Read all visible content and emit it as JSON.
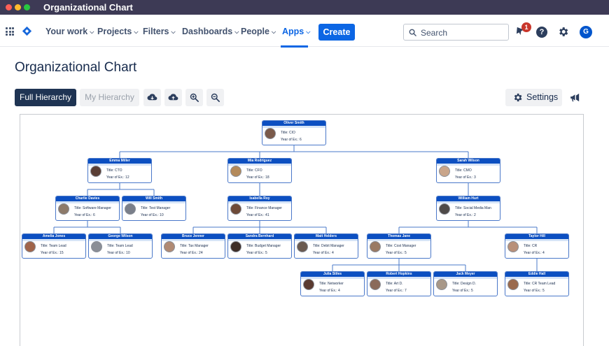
{
  "window": {
    "title": "Organizational Chart"
  },
  "nav": {
    "items": [
      {
        "label": "Your work",
        "caret": true
      },
      {
        "label": "Projects",
        "caret": true
      },
      {
        "label": "Filters",
        "caret": true
      },
      {
        "label": "Dashboards",
        "caret": true
      },
      {
        "label": "People",
        "caret": true
      },
      {
        "label": "Apps",
        "caret": true,
        "active": true
      }
    ],
    "create_label": "Create",
    "search_placeholder": "Search",
    "notification_count": "1",
    "help_glyph": "?",
    "avatar_initial": "G",
    "icons": [
      "app-switcher-icon",
      "jira-logo-icon",
      "search-icon",
      "notification-icon",
      "help-icon",
      "settings-icon",
      "avatar"
    ]
  },
  "page": {
    "title": "Organizational Chart",
    "toolbar": {
      "full_hierarchy": "Full Hierarchy",
      "my_hierarchy": "My Hierarchy",
      "settings": "Settings",
      "icons": [
        "download-icon",
        "upload-icon",
        "zoom-in-icon",
        "zoom-out-icon",
        "gear-icon",
        "megaphone-icon"
      ]
    }
  },
  "colors": {
    "accent": "#0c66e4",
    "titlebar": "#3d3a55",
    "card_header": "#0c4fc1",
    "dark_button": "#1f3453"
  },
  "org": [
    {
      "name": "Oliver Smith",
      "title": "Title: CIO",
      "years": "Year of Ex.: 6",
      "photo": "#7a5a4a"
    },
    {
      "name": "Emma Miller",
      "title": "Title: CTO",
      "years": "Year of Ex.: 12",
      "photo": "#5a3e35"
    },
    {
      "name": "Mia Rodriguez",
      "title": "Title: CFO",
      "years": "Year of Ex.: 18",
      "photo": "#b48a5a"
    },
    {
      "name": "Sarah Wilson",
      "title": "Title: CMO",
      "years": "Year of Ex.: 3",
      "photo": "#c9a58a"
    },
    {
      "name": "Charlie Davies",
      "title": "Title: Software Manager",
      "years": "Year of Ex.: 6",
      "photo": "#8d7a6a"
    },
    {
      "name": "Will Smith",
      "title": "Title: Test Manager",
      "years": "Year of Ex.: 10",
      "photo": "#7a7f8a"
    },
    {
      "name": "Isabella Roy",
      "title": "Title: Finance Manager",
      "years": "Year of Ex.: 41",
      "photo": "#6e4a38"
    },
    {
      "name": "William Hurt",
      "title": "Title: Social Media Man",
      "years": "Year of Ex.: 2",
      "photo": "#4e4a48"
    },
    {
      "name": "Amelia Jones",
      "title": "Title: Team Lead",
      "years": "Year of Ex.: 15",
      "photo": "#a0644a"
    },
    {
      "name": "George Wilson",
      "title": "Title: Team Lead",
      "years": "Year of Ex.: 10",
      "photo": "#8a8e96"
    },
    {
      "name": "Bruce Jenner",
      "title": "Title: Tax Manager",
      "years": "Year of Ex.: 24",
      "photo": "#b08a74"
    },
    {
      "name": "Sandra Bernhard",
      "title": "Title: Budget Manager",
      "years": "Year of Ex.: 5",
      "photo": "#3e2e28"
    },
    {
      "name": "Matt Helders",
      "title": "Title: Debit Manager",
      "years": "Year of Ex.: 4",
      "photo": "#6a5a50"
    },
    {
      "name": "Thomas Jane",
      "title": "Title: Cost Manager",
      "years": "Year of Ex.: 5",
      "photo": "#9a7a64"
    },
    {
      "name": "Taylor Hill",
      "title": "Title: CR",
      "years": "Year of Ex.: 4",
      "photo": "#b8907a"
    },
    {
      "name": "Julia Stiles",
      "title": "Title: Networker",
      "years": "Year of Ex.: 4",
      "photo": "#5a3a30"
    },
    {
      "name": "Robert Hopkins",
      "title": "Title: Art D.",
      "years": "Year of Ex.: 7",
      "photo": "#8a6a5a"
    },
    {
      "name": "Jack Meyer",
      "title": "Title: Design D.",
      "years": "Year of Ex.: 5",
      "photo": "#a89888"
    },
    {
      "name": "Eddie Hall",
      "title": "Title: CR Team Lead",
      "years": "Year of Ex.: 5",
      "photo": "#9a6a4e"
    }
  ],
  "reports_to": {
    "Emma Miller": "Oliver Smith",
    "Mia Rodriguez": "Oliver Smith",
    "Sarah Wilson": "Oliver Smith",
    "Charlie Davies": "Emma Miller",
    "Will Smith": "Emma Miller",
    "Isabella Roy": "Mia Rodriguez",
    "William Hurt": "Sarah Wilson",
    "Amelia Jones": "Charlie Davies",
    "George Wilson": "Charlie Davies",
    "Bruce Jenner": "Isabella Roy",
    "Sandra Bernhard": "Isabella Roy",
    "Matt Helders": "Isabella Roy",
    "Thomas Jane": "William Hurt",
    "Taylor Hill": "William Hurt",
    "Julia Stiles": "Thomas Jane",
    "Robert Hopkins": "Thomas Jane",
    "Jack Meyer": "Thomas Jane",
    "Eddie Hall": "Taylor Hill"
  }
}
